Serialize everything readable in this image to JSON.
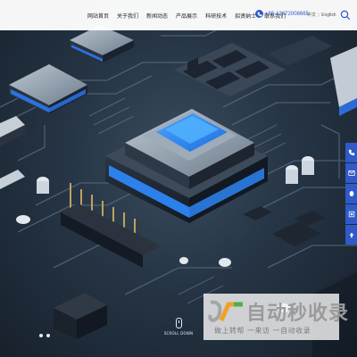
{
  "nav": {
    "items": [
      "网站首页",
      "关于我们",
      "新闻动态",
      "产品展示",
      "科研技术",
      "招贤纳士",
      "联系我们"
    ],
    "phone": "+86-13672008665",
    "lang_zh": "中文",
    "lang_en": "English"
  },
  "hero": {
    "scroll_label": "SCROLL DOWN",
    "slide_count": 2,
    "accent": "#2f5ac9",
    "chip_glow": "#2d8cff"
  },
  "sidebar": {
    "buttons": [
      "phone-icon",
      "email-icon",
      "qq-icon",
      "wechat-icon",
      "top-arrow-icon"
    ]
  },
  "watermark": {
    "brand": "自动秒收录",
    "slogan": "做上转帮 一来访 一自动收录"
  }
}
